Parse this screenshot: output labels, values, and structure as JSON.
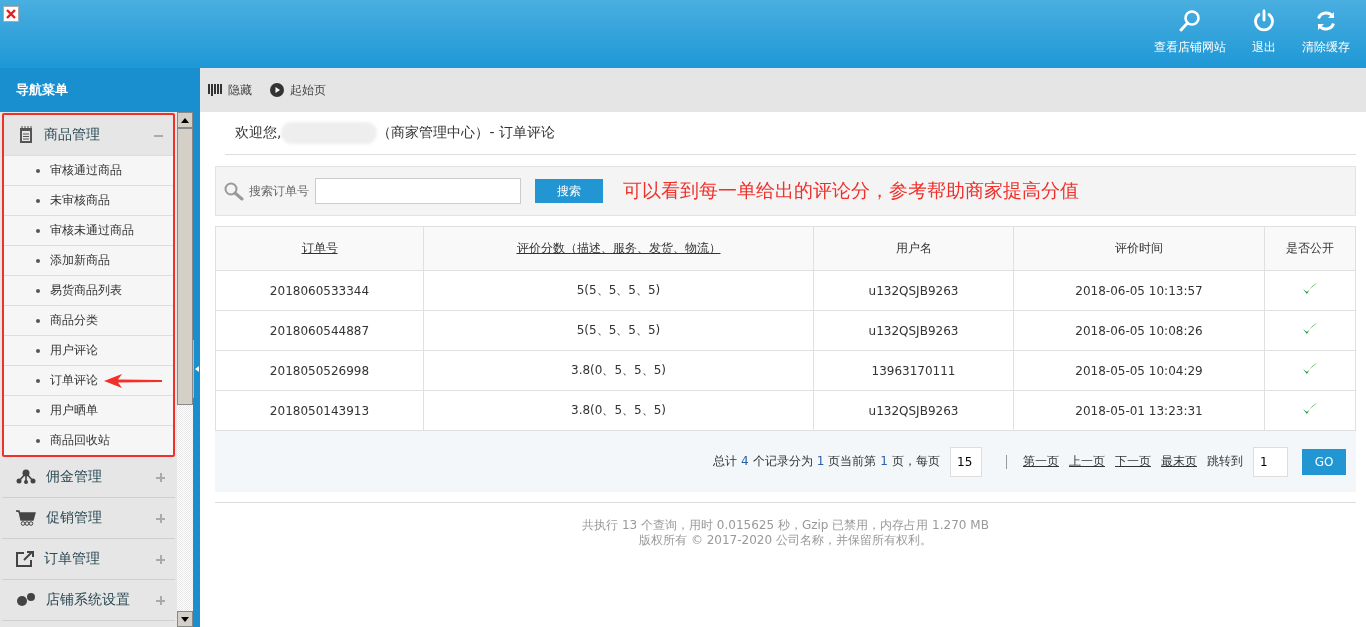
{
  "header": {
    "actions": [
      {
        "kind": "search",
        "label": "查看店铺网站"
      },
      {
        "kind": "power",
        "label": "退出"
      },
      {
        "kind": "refresh",
        "label": "清除缓存"
      }
    ]
  },
  "sidebar": {
    "title": "导航菜单",
    "groups": [
      {
        "kind": "goods",
        "label": "商品管理",
        "expanded": true,
        "children": [
          {
            "label": "审核通过商品"
          },
          {
            "label": "未审核商品"
          },
          {
            "label": "审核未通过商品"
          },
          {
            "label": "添加新商品"
          },
          {
            "label": "易货商品列表"
          },
          {
            "label": "商品分类"
          },
          {
            "label": "用户评论"
          },
          {
            "label": "订单评论"
          },
          {
            "label": "用户晒单"
          },
          {
            "label": "商品回收站"
          }
        ]
      },
      {
        "kind": "commission",
        "label": "佣金管理",
        "expanded": false
      },
      {
        "kind": "promo",
        "label": "促销管理",
        "expanded": false
      },
      {
        "kind": "order",
        "label": "订单管理",
        "expanded": false
      },
      {
        "kind": "settings",
        "label": "店铺系统设置",
        "expanded": false
      }
    ]
  },
  "toolbar": [
    {
      "kind": "hide",
      "label": "隐藏"
    },
    {
      "kind": "home",
      "label": "起始页"
    }
  ],
  "welcome": {
    "greeting": "欢迎您,",
    "suffix": "（商家管理中心）- 订单评论"
  },
  "search": {
    "label": "搜索订单号",
    "button": "搜索"
  },
  "annotation": {
    "text": "可以看到每一单给出的评论分，参考帮助商家提高分值"
  },
  "table": {
    "columns": [
      {
        "label": "订单号",
        "sortable": true
      },
      {
        "label": "评价分数（描述、服务、发货、物流）",
        "sortable": true
      },
      {
        "label": "用户名",
        "sortable": false
      },
      {
        "label": "评价时间",
        "sortable": false
      },
      {
        "label": "是否公开",
        "sortable": false
      }
    ],
    "rows": [
      {
        "order": "2018060533344",
        "score": "5(5、5、5、5)",
        "user": "u132QSJB9263",
        "time": "2018-06-05 10:13:57",
        "public": true
      },
      {
        "order": "2018060544887",
        "score": "5(5、5、5、5)",
        "user": "u132QSJB9263",
        "time": "2018-06-05 10:08:26",
        "public": true
      },
      {
        "order": "2018050526998",
        "score": "3.8(0、5、5、5)",
        "user": "13963170111",
        "time": "2018-05-05 10:04:29",
        "public": true
      },
      {
        "order": "2018050143913",
        "score": "3.8(0、5、5、5)",
        "user": "u132QSJB9263",
        "time": "2018-05-01 13:23:31",
        "public": true
      }
    ]
  },
  "pagination": {
    "summary": [
      {
        "kind": "text",
        "text": "总计"
      },
      {
        "kind": "number",
        "text": "4"
      },
      {
        "kind": "text",
        "text": "个记录分为"
      },
      {
        "kind": "number",
        "text": "1"
      },
      {
        "kind": "text",
        "text": "页当前第"
      },
      {
        "kind": "number",
        "text": "1"
      },
      {
        "kind": "text",
        "text": "页，每页"
      }
    ],
    "per_page": "15",
    "links": [
      "第一页",
      "上一页",
      "下一页",
      "最末页"
    ],
    "jump_label": "跳转到",
    "jump_value": "1",
    "go": "GO"
  },
  "footer": [
    "共执行 13 个查询，用时 0.015625 秒，Gzip 已禁用，内存占用 1.270 MB",
    "版权所有 © 2017-2020 公司名称，并保留所有权利。"
  ]
}
